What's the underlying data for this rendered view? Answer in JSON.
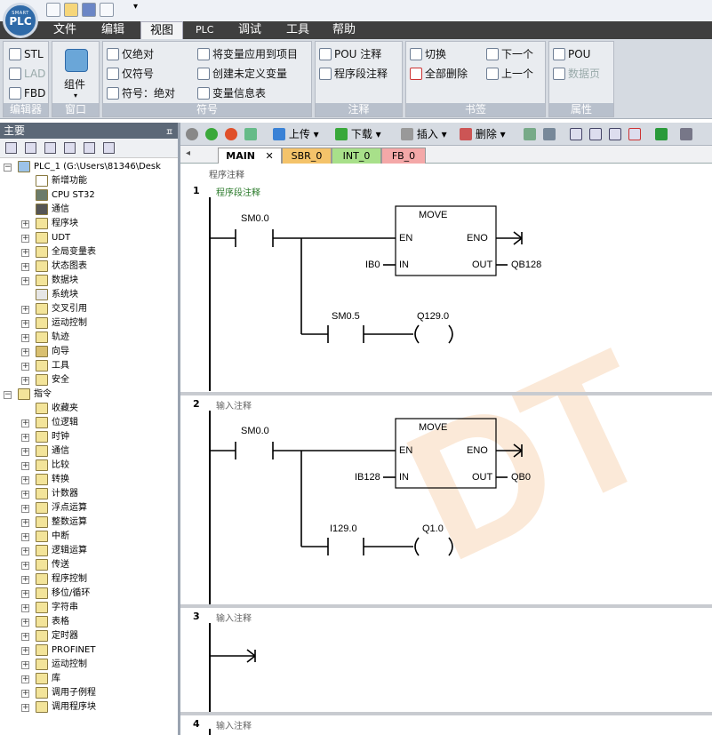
{
  "app": {
    "logo_small": "SMART",
    "logo_big": "PLC"
  },
  "menu": {
    "items": [
      "文件",
      "编辑",
      "视图",
      "PLC",
      "调试",
      "工具",
      "帮助"
    ],
    "active": "视图"
  },
  "ribbon": {
    "editor": {
      "label": "编辑器",
      "stl": "STL",
      "lad": "LAD",
      "fbd": "FBD"
    },
    "window": {
      "label": "窗口",
      "component": "组件"
    },
    "symbol": {
      "label": "符号",
      "abs_only": "仅绝对",
      "sym_only": "仅符号",
      "sym_abs": "符号：绝对",
      "apply_to_project": "将变量应用到项目",
      "create_undefined": "创建未定义变量",
      "var_info_table": "变量信息表"
    },
    "comment": {
      "label": "注释",
      "pou_comment": "POU 注释",
      "network_comment": "程序段注释"
    },
    "bookmark": {
      "label": "书签",
      "toggle": "切换",
      "delete_all": "全部删除",
      "next": "下一个",
      "prev": "上一个"
    },
    "property": {
      "label": "属性",
      "pou": "POU",
      "data_page": "数据页"
    }
  },
  "leftpane": {
    "title": "主要",
    "tree": [
      {
        "label": "PLC_1  (G:\\Users\\81346\\Desk",
        "level": 0,
        "expander": "−",
        "icon": "project-icon"
      },
      {
        "label": "新增功能",
        "level": 1,
        "expander": "",
        "icon": "help-icon"
      },
      {
        "label": "CPU ST32",
        "level": 1,
        "expander": "",
        "icon": "cpu-icon"
      },
      {
        "label": "通信",
        "level": 1,
        "expander": "",
        "icon": "communication-icon"
      },
      {
        "label": "程序块",
        "level": 1,
        "expander": "+",
        "icon": "folder-icon"
      },
      {
        "label": "UDT",
        "level": 1,
        "expander": "+",
        "icon": "folder-icon"
      },
      {
        "label": "全局变量表",
        "level": 1,
        "expander": "+",
        "icon": "folder-icon"
      },
      {
        "label": "状态图表",
        "level": 1,
        "expander": "+",
        "icon": "folder-icon"
      },
      {
        "label": "数据块",
        "level": 1,
        "expander": "+",
        "icon": "folder-icon"
      },
      {
        "label": "系统块",
        "level": 1,
        "expander": "",
        "icon": "system-block-icon"
      },
      {
        "label": "交叉引用",
        "level": 1,
        "expander": "+",
        "icon": "folder-icon"
      },
      {
        "label": "运动控制",
        "level": 1,
        "expander": "+",
        "icon": "folder-icon"
      },
      {
        "label": "轨迹",
        "level": 1,
        "expander": "+",
        "icon": "folder-icon"
      },
      {
        "label": "向导",
        "level": 1,
        "expander": "+",
        "icon": "wizard-icon"
      },
      {
        "label": "工具",
        "level": 1,
        "expander": "+",
        "icon": "folder-icon"
      },
      {
        "label": "安全",
        "level": 1,
        "expander": "+",
        "icon": "folder-icon"
      },
      {
        "label": "指令",
        "level": 0,
        "expander": "−",
        "icon": "instruction-icon"
      },
      {
        "label": "收藏夹",
        "level": 1,
        "expander": "",
        "icon": "folder-icon"
      },
      {
        "label": "位逻辑",
        "level": 1,
        "expander": "+",
        "icon": "folder-icon"
      },
      {
        "label": "时钟",
        "level": 1,
        "expander": "+",
        "icon": "folder-icon"
      },
      {
        "label": "通信",
        "level": 1,
        "expander": "+",
        "icon": "folder-icon"
      },
      {
        "label": "比较",
        "level": 1,
        "expander": "+",
        "icon": "folder-icon"
      },
      {
        "label": "转换",
        "level": 1,
        "expander": "+",
        "icon": "folder-icon"
      },
      {
        "label": "计数器",
        "level": 1,
        "expander": "+",
        "icon": "folder-icon"
      },
      {
        "label": "浮点运算",
        "level": 1,
        "expander": "+",
        "icon": "folder-icon"
      },
      {
        "label": "整数运算",
        "level": 1,
        "expander": "+",
        "icon": "folder-icon"
      },
      {
        "label": "中断",
        "level": 1,
        "expander": "+",
        "icon": "folder-icon"
      },
      {
        "label": "逻辑运算",
        "level": 1,
        "expander": "+",
        "icon": "folder-icon"
      },
      {
        "label": "传送",
        "level": 1,
        "expander": "+",
        "icon": "folder-icon"
      },
      {
        "label": "程序控制",
        "level": 1,
        "expander": "+",
        "icon": "folder-icon"
      },
      {
        "label": "移位/循环",
        "level": 1,
        "expander": "+",
        "icon": "folder-icon"
      },
      {
        "label": "字符串",
        "level": 1,
        "expander": "+",
        "icon": "folder-icon"
      },
      {
        "label": "表格",
        "level": 1,
        "expander": "+",
        "icon": "folder-icon"
      },
      {
        "label": "定时器",
        "level": 1,
        "expander": "+",
        "icon": "folder-icon"
      },
      {
        "label": "PROFINET",
        "level": 1,
        "expander": "+",
        "icon": "folder-icon"
      },
      {
        "label": "运动控制",
        "level": 1,
        "expander": "+",
        "icon": "folder-icon"
      },
      {
        "label": "库",
        "level": 1,
        "expander": "+",
        "icon": "folder-icon"
      },
      {
        "label": "调用子例程",
        "level": 1,
        "expander": "+",
        "icon": "folder-icon"
      },
      {
        "label": "调用程序块",
        "level": 1,
        "expander": "+",
        "icon": "folder-icon"
      }
    ]
  },
  "editor_toolbar": {
    "upload": "上传",
    "download": "下载",
    "insert": "插入",
    "delete": "删除"
  },
  "tabs": [
    {
      "label": "MAIN",
      "color": "#ffffff"
    },
    {
      "label": "SBR_0",
      "color": "#f4c36a"
    },
    {
      "label": "INT_0",
      "color": "#a8e08a"
    },
    {
      "label": "FB_0",
      "color": "#f4a8a8"
    }
  ],
  "program": {
    "program_comment": "程序注释",
    "networks": [
      {
        "number": "1",
        "comment": "程序段注释",
        "contact1": "SM0.0",
        "box_title": "MOVE",
        "en": "EN",
        "eno": "ENO",
        "in_pin": "IN",
        "out_pin": "OUT",
        "in_operand": "IB0",
        "out_operand": "QB128",
        "contact2": "SM0.5",
        "coil": "Q129.0"
      },
      {
        "number": "2",
        "comment": "输入注释",
        "contact1": "SM0.0",
        "box_title": "MOVE",
        "en": "EN",
        "eno": "ENO",
        "in_pin": "IN",
        "out_pin": "OUT",
        "in_operand": "IB128",
        "out_operand": "QB0",
        "contact2": "I129.0",
        "coil": "Q1.0"
      },
      {
        "number": "3",
        "comment": "输入注释"
      },
      {
        "number": "4",
        "comment": "输入注释"
      }
    ]
  }
}
